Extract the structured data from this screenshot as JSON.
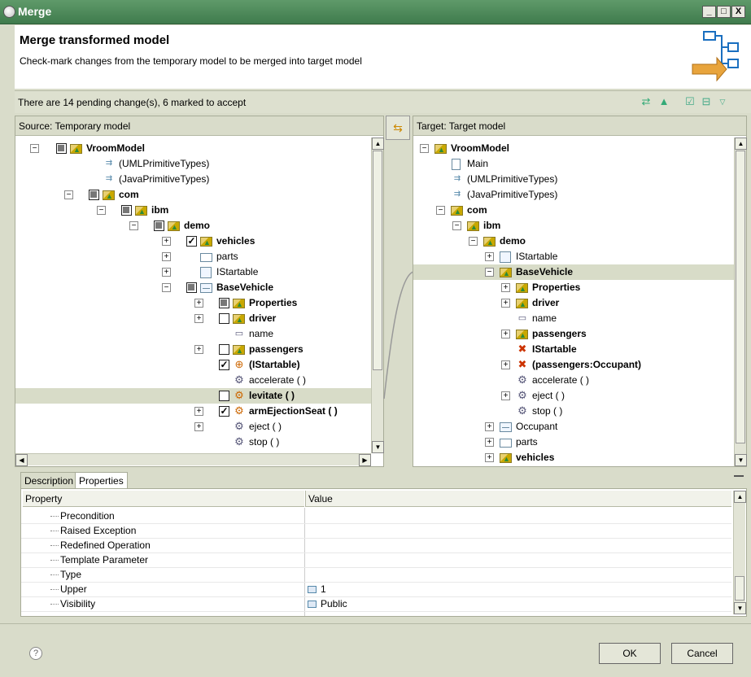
{
  "window": {
    "title": "Merge",
    "min": "_",
    "max": "□",
    "close": "X"
  },
  "header": {
    "title": "Merge transformed model",
    "description": "Check-mark changes from the temporary model to be merged into target model"
  },
  "status": {
    "text": "There are 14 pending change(s), 6 marked to accept"
  },
  "source": {
    "header": "Source: Temporary model",
    "rows": [
      {
        "label": "VroomModel",
        "bold": true
      },
      {
        "label": "(UMLPrimitiveTypes)",
        "bold": false
      },
      {
        "label": "(JavaPrimitiveTypes)",
        "bold": false
      },
      {
        "label": "com",
        "bold": true
      },
      {
        "label": "ibm",
        "bold": true
      },
      {
        "label": "demo",
        "bold": true
      },
      {
        "label": "vehicles",
        "bold": true
      },
      {
        "label": "parts",
        "bold": false
      },
      {
        "label": "IStartable",
        "bold": false
      },
      {
        "label": "BaseVehicle",
        "bold": true
      },
      {
        "label": "Properties",
        "bold": true
      },
      {
        "label": "driver",
        "bold": true
      },
      {
        "label": "name",
        "bold": false
      },
      {
        "label": "passengers",
        "bold": true
      },
      {
        "label": "(IStartable)",
        "bold": true
      },
      {
        "label": "accelerate ( )",
        "bold": false
      },
      {
        "label": "levitate ( )",
        "bold": true
      },
      {
        "label": "armEjectionSeat ( )",
        "bold": true
      },
      {
        "label": "eject ( )",
        "bold": false
      },
      {
        "label": "stop ( )",
        "bold": false
      }
    ]
  },
  "target": {
    "header": "Target: Target model",
    "rows": [
      {
        "label": "VroomModel",
        "bold": true
      },
      {
        "label": "Main",
        "bold": false
      },
      {
        "label": "(UMLPrimitiveTypes)",
        "bold": false
      },
      {
        "label": "(JavaPrimitiveTypes)",
        "bold": false
      },
      {
        "label": "com",
        "bold": true
      },
      {
        "label": "ibm",
        "bold": true
      },
      {
        "label": "demo",
        "bold": true
      },
      {
        "label": "IStartable",
        "bold": false
      },
      {
        "label": "BaseVehicle",
        "bold": true
      },
      {
        "label": "Properties",
        "bold": true
      },
      {
        "label": "driver",
        "bold": true
      },
      {
        "label": "name",
        "bold": false
      },
      {
        "label": "passengers",
        "bold": true
      },
      {
        "label": "IStartable",
        "bold": true
      },
      {
        "label": "(passengers:Occupant)",
        "bold": true
      },
      {
        "label": "accelerate ( )",
        "bold": false
      },
      {
        "label": "eject ( )",
        "bold": false
      },
      {
        "label": "stop ( )",
        "bold": false
      },
      {
        "label": "Occupant",
        "bold": false
      },
      {
        "label": "parts",
        "bold": false
      },
      {
        "label": "vehicles",
        "bold": true
      }
    ]
  },
  "tabs": {
    "description": "Description",
    "properties": "Properties"
  },
  "properties": {
    "col_property": "Property",
    "col_value": "Value",
    "rows": [
      {
        "name": "Precondition",
        "value": ""
      },
      {
        "name": "Raised Exception",
        "value": ""
      },
      {
        "name": "Redefined Operation",
        "value": ""
      },
      {
        "name": "Template Parameter",
        "value": ""
      },
      {
        "name": "Type",
        "value": ""
      },
      {
        "name": "Upper",
        "value": "1"
      },
      {
        "name": "Visibility",
        "value": "Public"
      }
    ]
  },
  "footer": {
    "help": "?",
    "ok": "OK",
    "cancel": "Cancel"
  }
}
